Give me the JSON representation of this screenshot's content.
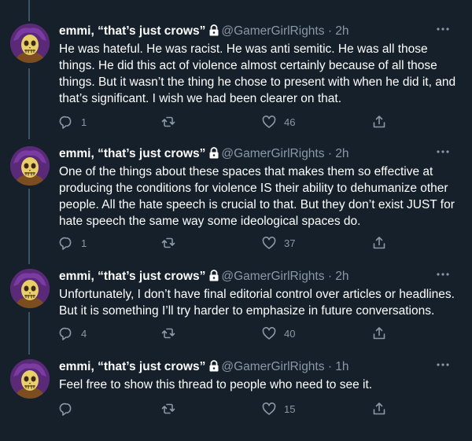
{
  "tweets": [
    {
      "author_name": "emmi, “that’s just crows”",
      "handle": "@GamerGirlRights",
      "separator": "·",
      "time": "2h",
      "text": "He was hateful. He was racist. He was anti semitic. He was all those things. He did this act of violence almost certainly because of all those things. But it wasn’t the thing he chose to present with when he did it, and that’s significant. I wish we had been clearer on that.",
      "replies": "1",
      "retweets": "",
      "likes": "46"
    },
    {
      "author_name": "emmi, “that’s just crows”",
      "handle": "@GamerGirlRights",
      "separator": "·",
      "time": "2h",
      "text": "One of the things about these spaces that makes them so effective at producing the conditions for violence IS their ability to dehumanize other people. All the hate speech is crucial to that. But they don’t exist JUST for hate speech the same way some ideological spaces do.",
      "replies": "1",
      "retweets": "",
      "likes": "37"
    },
    {
      "author_name": "emmi, “that’s just crows”",
      "handle": "@GamerGirlRights",
      "separator": "·",
      "time": "2h",
      "text": "Unfortunately, I don’t have final editorial control over articles or headlines. But it is something I’ll try harder to emphasize in future conversations.",
      "replies": "4",
      "retweets": "",
      "likes": "40"
    },
    {
      "author_name": "emmi, “that’s just crows”",
      "handle": "@GamerGirlRights",
      "separator": "·",
      "time": "1h",
      "text": "Feel free to show this thread to people who need to see it.",
      "replies": "",
      "retweets": "",
      "likes": "15"
    }
  ],
  "icons": {
    "reply": "reply-icon",
    "retweet": "retweet-icon",
    "like": "heart-icon",
    "share": "share-icon",
    "more": "more-icon",
    "lock": "lock-icon"
  },
  "colors": {
    "background": "#15202b",
    "text": "#ffffff",
    "muted": "#8b98a5",
    "thread_line": "#3d5466"
  }
}
